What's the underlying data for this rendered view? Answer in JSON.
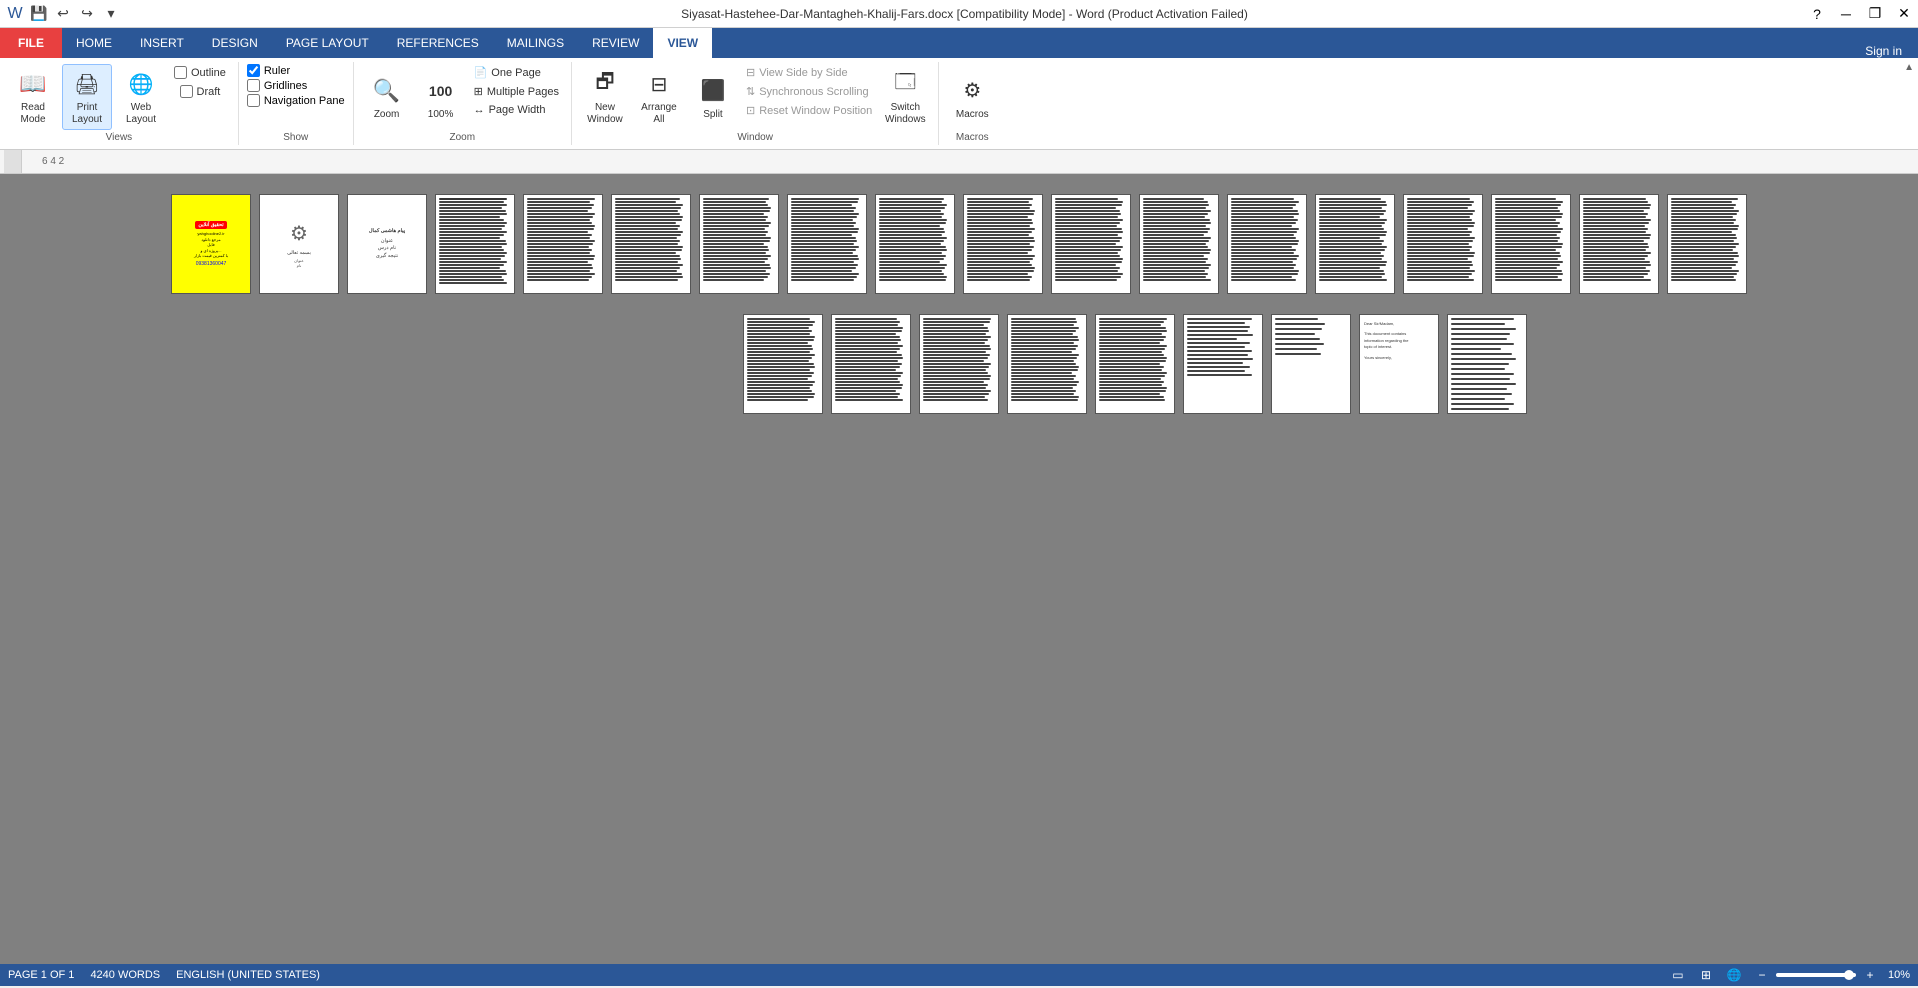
{
  "titlebar": {
    "title": "Siyasat-Hastehee-Dar-Mantagheh-Khalij-Fars.docx [Compatibility Mode] - Word (Product Activation Failed)",
    "help_btn": "?",
    "min_btn": "─",
    "restore_btn": "❐",
    "close_btn": "✕",
    "signin": "Sign in"
  },
  "qat": {
    "save_icon": "💾",
    "undo_icon": "↩",
    "redo_icon": "↪",
    "customize_icon": "▾"
  },
  "ribbon": {
    "tabs": [
      "FILE",
      "HOME",
      "INSERT",
      "DESIGN",
      "PAGE LAYOUT",
      "REFERENCES",
      "MAILINGS",
      "REVIEW",
      "VIEW"
    ],
    "active_tab": "VIEW",
    "groups": {
      "views": {
        "label": "Views",
        "read_mode_label": "Read\nMode",
        "print_layout_label": "Print\nLayout",
        "web_layout_label": "Web\nLayout",
        "outline_label": "Outline",
        "draft_label": "Draft"
      },
      "show": {
        "label": "Show",
        "ruler_label": "Ruler",
        "ruler_checked": true,
        "gridlines_label": "Gridlines",
        "gridlines_checked": false,
        "navigation_pane_label": "Navigation Pane",
        "navigation_pane_checked": false
      },
      "zoom": {
        "label": "Zoom",
        "zoom_label": "Zoom",
        "zoom_100_label": "100%",
        "one_page_label": "One Page",
        "multiple_pages_label": "Multiple Pages",
        "page_width_label": "Page Width"
      },
      "window": {
        "label": "Window",
        "new_window_label": "New\nWindow",
        "arrange_all_label": "Arrange\nAll",
        "split_label": "Split",
        "view_side_by_side_label": "View Side by Side",
        "synchronous_scrolling_label": "Synchronous Scrolling",
        "reset_window_position_label": "Reset Window Position",
        "switch_windows_label": "Switch\nWindows"
      },
      "macros": {
        "label": "Macros",
        "macros_label": "Macros"
      }
    }
  },
  "ruler": {
    "values": "6  4  2"
  },
  "statusbar": {
    "page_info": "PAGE 1 OF 1",
    "word_count": "4240 WORDS",
    "language": "ENGLISH (UNITED STATES)",
    "zoom_percent": "10%"
  },
  "document": {
    "row1_pages": 18,
    "row2_pages": 9,
    "first_page_type": "cover"
  }
}
